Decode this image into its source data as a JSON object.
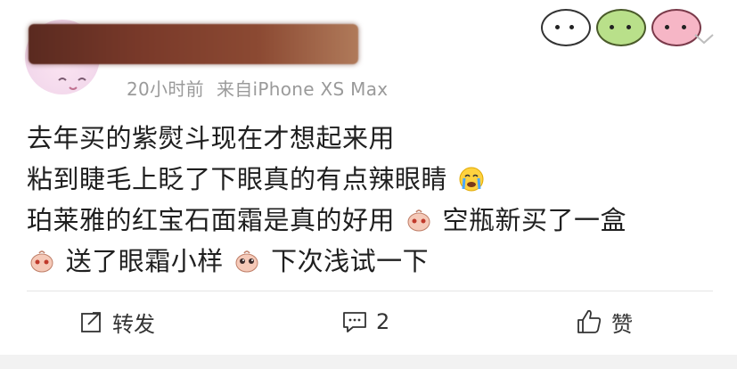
{
  "post": {
    "time": "20小时前",
    "source": "来自iPhone XS Max",
    "lines": [
      "去年买的紫熨斗现在才想起来用",
      "粘到睫毛上眨了下眼真的有点辣眼睛",
      "珀莱雅的红宝石面霜是真的好用",
      "空瓶新买了一盒",
      "送了眼霜小样",
      "下次浅试一下"
    ]
  },
  "actions": {
    "repost_label": "转发",
    "comment_count": "2",
    "like_label": "赞"
  },
  "icons": {
    "stickers": [
      "chick-sticker-icon",
      "frog-sticker-icon",
      "pig-sticker-icon"
    ],
    "more": "chevron-down-icon",
    "repost": "share-arrow-icon",
    "comment": "comment-icon",
    "like": "thumbs-up-icon",
    "emojis": [
      "crying-face-emoji",
      "pink-character-emoji",
      "pink-character-emoji",
      "pink-character-pleading-emoji"
    ]
  },
  "colors": {
    "meta_text": "#9a9a9a",
    "body_text": "#1f1f1f",
    "divider": "#e5e5e5"
  }
}
